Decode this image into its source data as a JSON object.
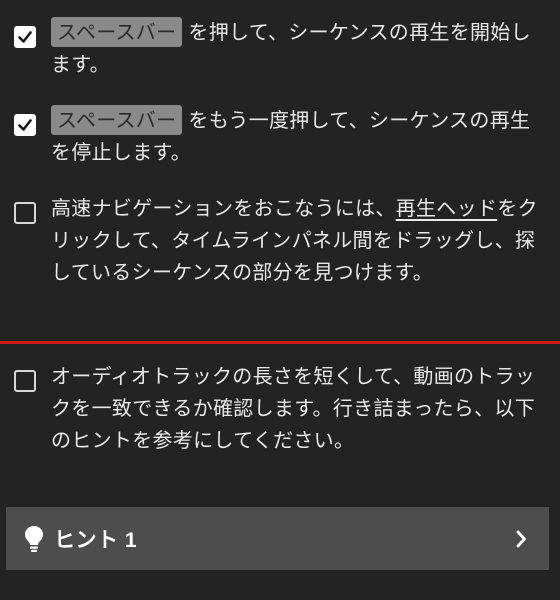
{
  "tasks": [
    {
      "checked": true,
      "key_label": "スペースバー",
      "text_after_key": "を押して、シーケンスの再生を開始します。"
    },
    {
      "checked": true,
      "key_label": "スペースバー",
      "text_after_key": "をもう一度押して、シーケンスの再生を停止します。"
    },
    {
      "checked": false,
      "text_before_link": "高速ナビゲーションをおこなうには、",
      "link_text": "再生ヘッド",
      "text_after_link": "をクリックして、タイムラインパネル間をドラッグし、探しているシーケンスの部分を見つけます。"
    },
    {
      "checked": false,
      "text": "オーディオトラックの長さを短くして、動画のトラックを一致できるか確認します。行き詰まったら、以下のヒントを参考にしてください。"
    }
  ],
  "hint": {
    "label": "ヒント 1",
    "icon": "lightbulb-icon",
    "chevron_icon": "chevron-right-icon"
  },
  "colors": {
    "background": "#232323",
    "divider": "#d01818",
    "hint_bar": "#4d4d4d",
    "key_chip": "#8a8a8a"
  }
}
